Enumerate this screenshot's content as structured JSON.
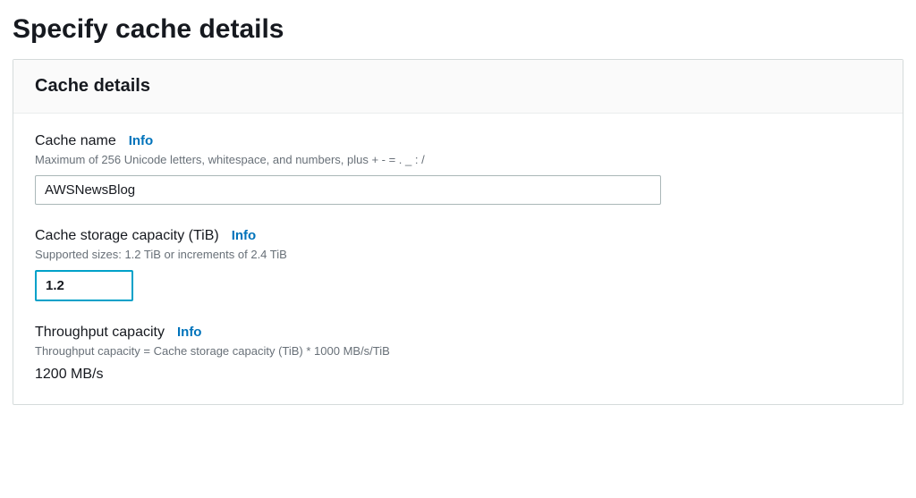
{
  "page_title": "Specify cache details",
  "panel_title": "Cache details",
  "fields": {
    "cache_name": {
      "label": "Cache name",
      "info_label": "Info",
      "description": "Maximum of 256 Unicode letters, whitespace, and numbers, plus + - = . _ : /",
      "value": "AWSNewsBlog"
    },
    "storage_capacity": {
      "label": "Cache storage capacity (TiB)",
      "info_label": "Info",
      "description": "Supported sizes: 1.2 TiB or increments of 2.4 TiB",
      "value": "1.2"
    },
    "throughput": {
      "label": "Throughput capacity",
      "info_label": "Info",
      "description": "Throughput capacity = Cache storage capacity (TiB) * 1000 MB/s/TiB",
      "value": "1200 MB/s"
    }
  }
}
